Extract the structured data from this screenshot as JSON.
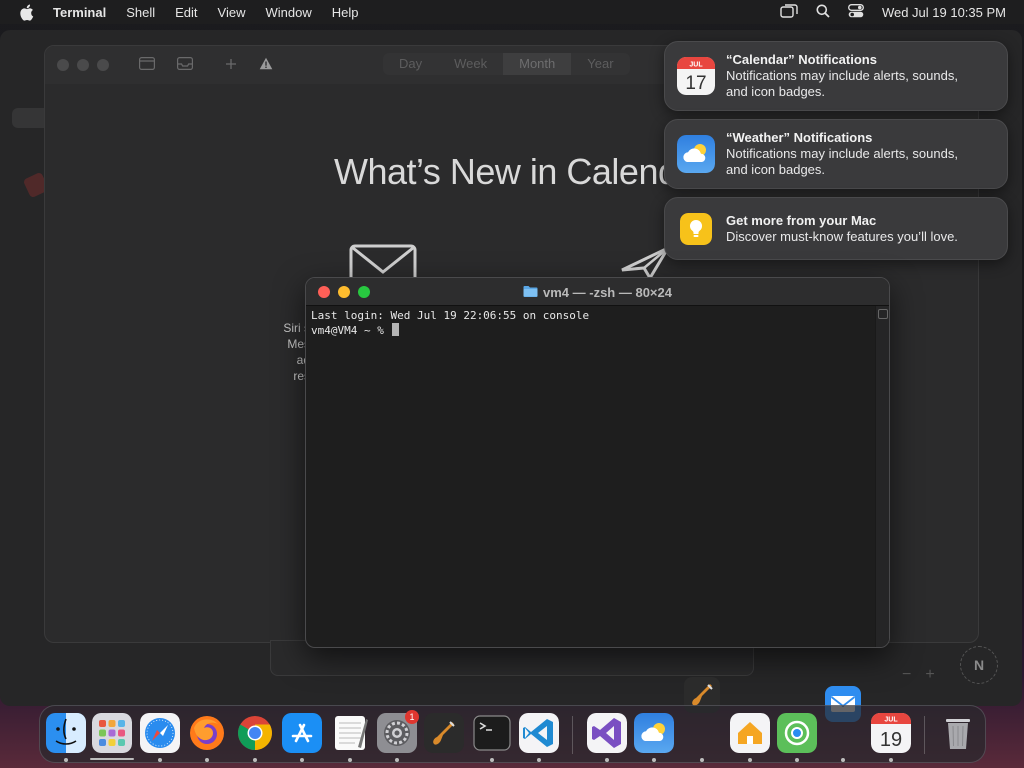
{
  "menubar": {
    "app_name": "Terminal",
    "items": [
      "Shell",
      "Edit",
      "View",
      "Window",
      "Help"
    ],
    "clock": "Wed Jul 19  10:35 PM",
    "status_icons": [
      "window-switcher-icon",
      "search-icon",
      "control-center-icon"
    ]
  },
  "calendar_window": {
    "view_segments": [
      "Day",
      "Week",
      "Month",
      "Year"
    ],
    "active_segment": "Month",
    "headline": "What’s New in Calenda",
    "side_text": [
      "Siri s",
      "Mes",
      "ad",
      "res"
    ]
  },
  "notifications": [
    {
      "icon": "calendar-icon",
      "title": "“Calendar” Notifications",
      "body_line1": "Notifications may include alerts, sounds,",
      "body_line2": "and icon badges."
    },
    {
      "icon": "weather-icon",
      "title": "“Weather” Notifications",
      "body_line1": "Notifications may include alerts, sounds,",
      "body_line2": "and icon badges."
    },
    {
      "icon": "tips-icon",
      "title": "Get more from your Mac",
      "body_line1": "Discover must-know features you’ll love.",
      "body_line2": ""
    }
  ],
  "calendar_icon": {
    "month": "JUL",
    "day": "17"
  },
  "terminal": {
    "title": "vm4 — -zsh — 80×24",
    "line1": "Last login: Wed Jul 19 22:06:55 on console",
    "prompt": "vm4@VM4 ~ % "
  },
  "map_compass": "N",
  "dock": {
    "items": [
      "finder",
      "launchpad",
      "safari",
      "firefox",
      "chrome",
      "app-store",
      "textedit",
      "system-settings",
      "garageband",
      "terminal",
      "vscode",
      "visual-studio",
      "weather",
      "home",
      "find-my",
      "calendar",
      "trash"
    ],
    "system_settings_badge": "1",
    "calendar_month": "JUL",
    "calendar_day": "19"
  },
  "colors": {
    "close": "#fe5f57",
    "minimize": "#febc2e",
    "zoom": "#28c840"
  }
}
